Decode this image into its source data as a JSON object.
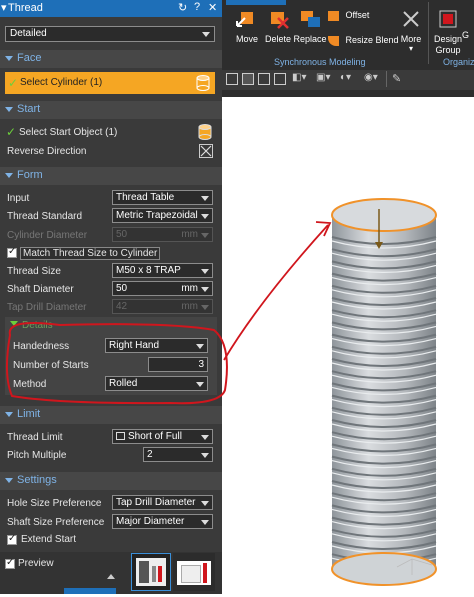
{
  "window": {
    "title": "Thread"
  },
  "top_select": {
    "value": "Detailed"
  },
  "face": {
    "header": "Face",
    "select_label": "Select Cylinder (1)"
  },
  "start": {
    "header": "Start",
    "select_label": "Select Start Object (1)",
    "reverse_label": "Reverse Direction"
  },
  "form": {
    "header": "Form",
    "input_label": "Input",
    "input_value": "Thread Table",
    "standard_label": "Thread Standard",
    "standard_value": "Metric Trapezoidal",
    "cyl_diam_label": "Cylinder Diameter",
    "cyl_diam_value": "50",
    "cyl_diam_unit": "mm",
    "match_label": "Match Thread Size to Cylinder",
    "size_label": "Thread Size",
    "size_value": "M50 x 8 TRAP",
    "shaft_label": "Shaft Diameter",
    "shaft_value": "50",
    "shaft_unit": "mm",
    "tap_label": "Tap Drill Diameter",
    "tap_value": "42",
    "tap_unit": "mm"
  },
  "details": {
    "header": "Details",
    "handedness_label": "Handedness",
    "handedness_value": "Right Hand",
    "starts_label": "Number of Starts",
    "starts_value": "3",
    "method_label": "Method",
    "method_value": "Rolled"
  },
  "limit": {
    "header": "Limit",
    "thread_limit_label": "Thread Limit",
    "thread_limit_value": "Short of Full",
    "pitch_label": "Pitch Multiple",
    "pitch_value": "2"
  },
  "settings": {
    "header": "Settings",
    "hole_label": "Hole Size Preference",
    "hole_value": "Tap Drill Diameter",
    "shaft_pref_label": "Shaft Size Preference",
    "shaft_pref_value": "Major Diameter",
    "extend_label": "Extend Start"
  },
  "footer": {
    "preview_label": "Preview"
  },
  "ribbon": {
    "move": "Move",
    "delete": "Delete",
    "replace": "Replace",
    "offset": "Offset",
    "resize_blend": "Resize Blend",
    "more": "More",
    "design_group": "Design Group",
    "group_label": "Synchronous Modeling",
    "org_label": "Organiz",
    "g_cut": "G"
  },
  "colors": {
    "accent_blue": "#1e6fb8",
    "selection_orange": "#f5a623",
    "annotation_red": "#d0161d",
    "cylinder_grey": "#b8bcc0",
    "ring_orange": "#f0922a"
  }
}
